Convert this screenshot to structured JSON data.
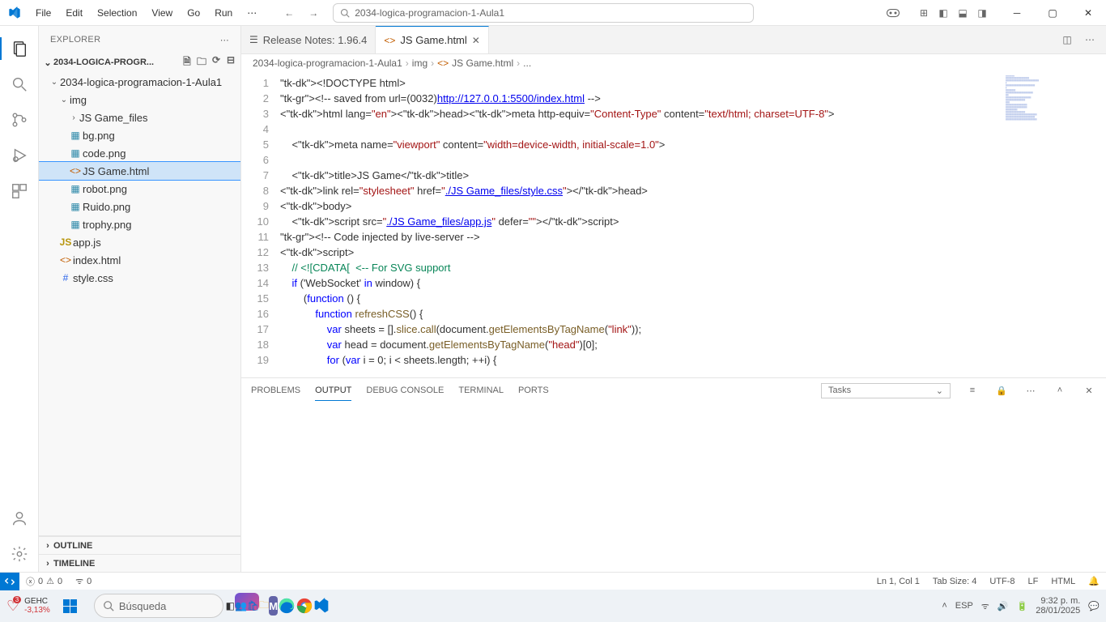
{
  "menubar": [
    "File",
    "Edit",
    "Selection",
    "View",
    "Go",
    "Run"
  ],
  "search_placeholder": "2034-logica-programacion-1-Aula1",
  "explorer_label": "EXPLORER",
  "project_name": "2034-LOGICA-PROGR...",
  "root_folder": "2034-logica-programacion-1-Aula1",
  "tree": {
    "img": "img",
    "js_files": "JS Game_files",
    "bg": "bg.png",
    "code": "code.png",
    "jsgame": "JS Game.html",
    "robot": "robot.png",
    "ruido": "Ruido.png",
    "trophy": "trophy.png",
    "appjs": "app.js",
    "index": "index.html",
    "stylecss": "style.css"
  },
  "outline": "OUTLINE",
  "timeline": "TIMELINE",
  "tabs": {
    "release": "Release Notes: 1.96.4",
    "jsgame": "JS Game.html"
  },
  "crumbs": [
    "2034-logica-programacion-1-Aula1",
    "img",
    "JS Game.html",
    "..."
  ],
  "code_lines": [
    "<!DOCTYPE html>",
    "<!-- saved from url=(0032)http://127.0.0.1:5500/index.html -->",
    "<html lang=\"en\"><head><meta http-equiv=\"Content-Type\" content=\"text/html; charset=UTF-8\">",
    "",
    "    <meta name=\"viewport\" content=\"width=device-width, initial-scale=1.0\">",
    "",
    "    <title>JS Game</title>",
    "<link rel=\"stylesheet\" href=\"./JS Game_files/style.css\"></head>",
    "<body>",
    "    <script src=\"./JS Game_files/app.js\" defer=\"\"></script>",
    "<!-- Code injected by live-server -->",
    "<script>",
    "    // <![CDATA[  <-- For SVG support",
    "    if ('WebSocket' in window) {",
    "        (function () {",
    "            function refreshCSS() {",
    "                var sheets = [].slice.call(document.getElementsByTagName(\"link\"));",
    "                var head = document.getElementsByTagName(\"head\")[0];",
    "                for (var i = 0; i < sheets.length; ++i) {"
  ],
  "panel": {
    "tabs": [
      "PROBLEMS",
      "OUTPUT",
      "DEBUG CONSOLE",
      "TERMINAL",
      "PORTS"
    ],
    "active": "OUTPUT",
    "select": "Tasks"
  },
  "status": {
    "errors": "0",
    "warnings": "0",
    "port": "0",
    "ln": "Ln 1, Col 1",
    "tab": "Tab Size: 4",
    "enc": "UTF-8",
    "eol": "LF",
    "lang": "HTML"
  },
  "taskbar": {
    "stock_sym": "GEHC",
    "stock_chg": "-3,13%",
    "stock_badge": "3",
    "search": "Búsqueda",
    "lang": "ESP",
    "time": "9:32 p. m.",
    "date": "28/01/2025"
  }
}
